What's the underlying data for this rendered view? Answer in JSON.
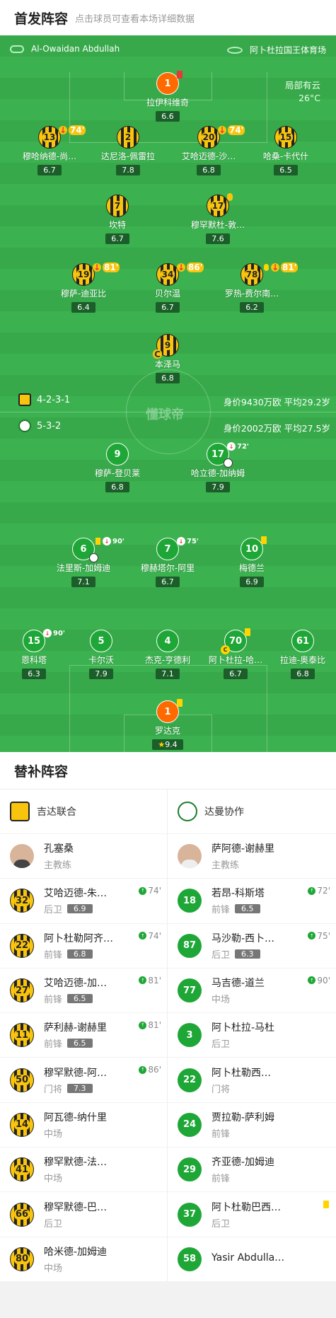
{
  "header": {
    "title": "首发阵容",
    "subtitle": "点击球员可查看本场详细数据"
  },
  "match": {
    "referee": "Al-Owaidan Abdullah",
    "venue": "阿卜杜拉国王体育场",
    "weather": "局部有云",
    "temperature": "26°C"
  },
  "home_formation": {
    "formation": "4-2-3-1",
    "stats": "身价9430万欧  平均29.2岁"
  },
  "away_formation": {
    "formation": "5-3-2",
    "stats": "身价2002万欧  平均27.5岁"
  },
  "home_players": [
    {
      "num": "1",
      "name": "拉伊科维奇",
      "rating": "6.6"
    },
    {
      "num": "13",
      "name": "穆哈纳德-尚…",
      "rating": "6.7",
      "sub": "74'"
    },
    {
      "num": "2",
      "name": "达尼洛-佩雷拉",
      "rating": "7.8"
    },
    {
      "num": "20",
      "name": "艾哈迈德-沙…",
      "rating": "6.8",
      "sub": "74'"
    },
    {
      "num": "15",
      "name": "哈桑-卡代什",
      "rating": "6.5"
    },
    {
      "num": "7",
      "name": "坎特",
      "rating": "6.7"
    },
    {
      "num": "17",
      "name": "穆罕默杜-敦…",
      "rating": "7.6"
    },
    {
      "num": "19",
      "name": "穆萨-迪亚比",
      "rating": "6.4",
      "sub": "81'"
    },
    {
      "num": "34",
      "name": "贝尔温",
      "rating": "6.7",
      "sub": "86'"
    },
    {
      "num": "78",
      "name": "罗热-费尔南…",
      "rating": "6.2",
      "sub": "81'"
    },
    {
      "num": "9",
      "name": "本泽马",
      "rating": "6.8"
    }
  ],
  "away_players": [
    {
      "num": "9",
      "name": "穆萨-登贝莱",
      "rating": "6.8"
    },
    {
      "num": "17",
      "name": "哈立德-加纳姆",
      "rating": "7.9",
      "sub": "72'"
    },
    {
      "num": "6",
      "name": "法里斯-加姆迪",
      "rating": "7.1",
      "sub": "90'"
    },
    {
      "num": "7",
      "name": "穆赫塔尔-阿里",
      "rating": "6.7",
      "sub": "75'"
    },
    {
      "num": "10",
      "name": "梅德兰",
      "rating": "6.9"
    },
    {
      "num": "15",
      "name": "恩科塔",
      "rating": "6.3",
      "sub": "90'"
    },
    {
      "num": "5",
      "name": "卡尔沃",
      "rating": "7.9"
    },
    {
      "num": "4",
      "name": "杰克-亨德利",
      "rating": "7.1"
    },
    {
      "num": "70",
      "name": "阿卜杜拉-哈…",
      "rating": "6.7"
    },
    {
      "num": "61",
      "name": "拉迪-奥泰比",
      "rating": "6.8"
    },
    {
      "num": "1",
      "name": "罗达克",
      "rating": "9.4"
    }
  ],
  "subs": {
    "title": "替补阵容",
    "home_team": "吉达联合",
    "away_team": "达曼协作",
    "home_coach": {
      "name": "孔塞桑",
      "role": "主教练"
    },
    "away_coach": {
      "name": "萨阿德-谢赫里",
      "role": "主教练"
    },
    "home": [
      {
        "num": "32",
        "name": "艾哈迈德-朱…",
        "pos": "后卫",
        "rating": "6.9",
        "in": "74'"
      },
      {
        "num": "22",
        "name": "阿卜杜勒阿齐…",
        "pos": "前锋",
        "rating": "6.8",
        "in": "74'"
      },
      {
        "num": "27",
        "name": "艾哈迈德-加…",
        "pos": "前锋",
        "rating": "6.5",
        "in": "81'"
      },
      {
        "num": "11",
        "name": "萨利赫-谢赫里",
        "pos": "前锋",
        "rating": "6.5",
        "in": "81'"
      },
      {
        "num": "50",
        "name": "穆罕默德-阿…",
        "pos": "门将",
        "rating": "7.3",
        "in": "86'"
      },
      {
        "num": "14",
        "name": "阿瓦德-纳什里",
        "pos": "中场",
        "rating": "",
        "in": ""
      },
      {
        "num": "41",
        "name": "穆罕默德-法…",
        "pos": "中场",
        "rating": "",
        "in": ""
      },
      {
        "num": "66",
        "name": "穆罕默德-巴…",
        "pos": "后卫",
        "rating": "",
        "in": ""
      },
      {
        "num": "80",
        "name": "哈米德-加姆迪",
        "pos": "中场",
        "rating": "",
        "in": ""
      }
    ],
    "away": [
      {
        "num": "18",
        "name": "若昂-科斯塔",
        "pos": "前锋",
        "rating": "6.5",
        "in": "72'"
      },
      {
        "num": "87",
        "name": "马沙勒-西卜…",
        "pos": "后卫",
        "rating": "6.3",
        "in": "75'"
      },
      {
        "num": "77",
        "name": "马吉德-道兰",
        "pos": "中场",
        "rating": "",
        "in": "90'"
      },
      {
        "num": "3",
        "name": "阿卜杜拉-马杜",
        "pos": "后卫",
        "rating": "",
        "in": ""
      },
      {
        "num": "22",
        "name": "阿卜杜勒西…",
        "pos": "门将",
        "rating": "",
        "in": ""
      },
      {
        "num": "24",
        "name": "贾拉勒-萨利姆",
        "pos": "前锋",
        "rating": "",
        "in": ""
      },
      {
        "num": "29",
        "name": "齐亚德-加姆迪",
        "pos": "前锋",
        "rating": "",
        "in": ""
      },
      {
        "num": "37",
        "name": "阿卜杜勒巴西…",
        "pos": "后卫",
        "rating": "",
        "in": ""
      },
      {
        "num": "58",
        "name": "Yasir Abdulla…",
        "pos": "",
        "rating": "",
        "in": ""
      }
    ]
  },
  "watermark": "懂球帝"
}
